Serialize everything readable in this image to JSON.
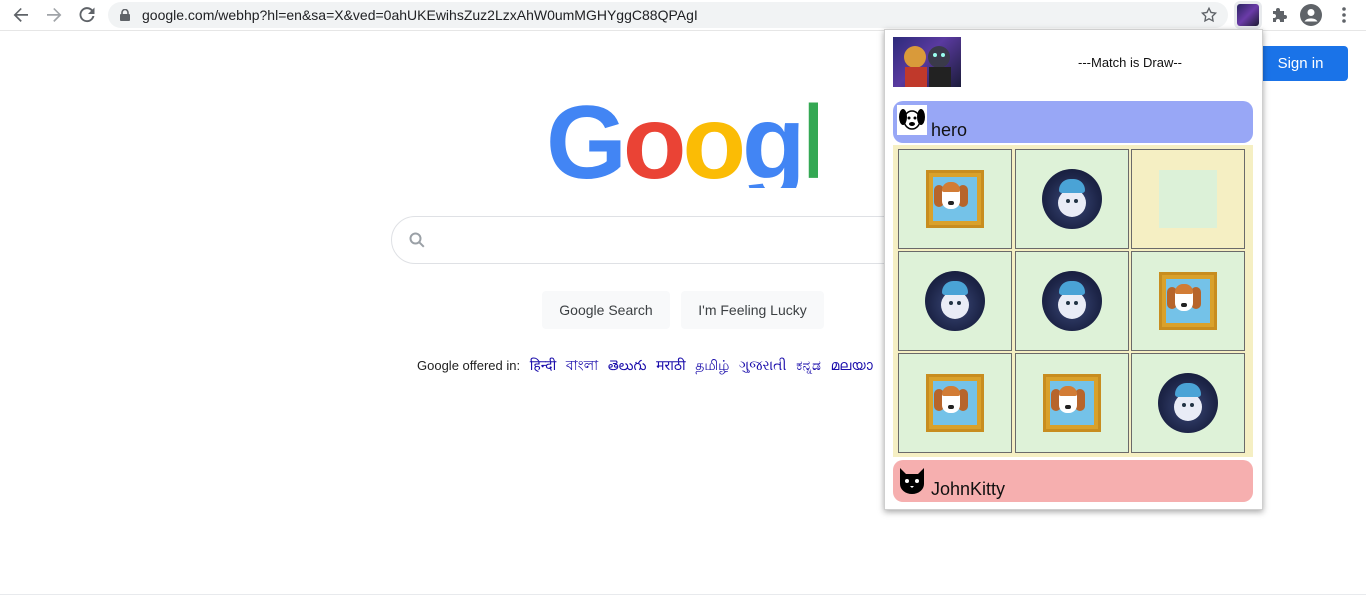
{
  "browser": {
    "url": "google.com/webhp?hl=en&sa=X&ved=0ahUKEwihsZuz2LzxAhW0umMGHYggC88QPAgI",
    "back_icon": "arrow-left-icon",
    "forward_icon": "arrow-right-icon",
    "reload_icon": "reload-icon",
    "lock_icon": "lock-icon",
    "bookmark_icon": "star-icon",
    "extensions_icon": "puzzle-icon",
    "profile_icon": "person-icon",
    "menu_icon": "kebab-menu-icon"
  },
  "google": {
    "logo_text": "Google",
    "search_button": "Google Search",
    "lucky_button": "I'm Feeling Lucky",
    "offered_label": "Google offered in:",
    "languages": [
      "हिन्दी",
      "বাংলা",
      "తెలుగు",
      "मराठी",
      "தமிழ்",
      "ગુજરાતી",
      "ಕನ್ನಡ",
      "മലയാ"
    ],
    "sign_in": "Sign in"
  },
  "popup": {
    "status": "---Match is Draw--",
    "player1": {
      "name": "hero",
      "icon": "dog-icon"
    },
    "player2": {
      "name": "JohnKitty",
      "icon": "cat-icon"
    },
    "board": [
      [
        "puppy",
        "kitty",
        ""
      ],
      [
        "kitty",
        "kitty",
        "puppy"
      ],
      [
        "puppy",
        "puppy",
        "kitty"
      ]
    ]
  }
}
